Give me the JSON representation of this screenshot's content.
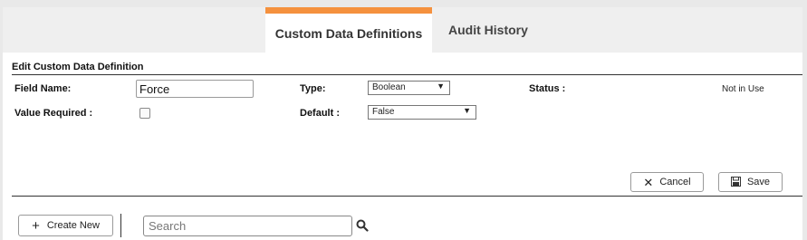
{
  "tabs": {
    "active_label": "Custom Data Definitions",
    "inactive_label": "Audit History",
    "accent_color": "#f5913e"
  },
  "form": {
    "section_title": "Edit Custom Data Definition",
    "field_name_label": "Field Name:",
    "field_name_value": "Force",
    "type_label": "Type:",
    "type_value": "Boolean",
    "status_label": "Status :",
    "status_value": "Not in Use",
    "value_required_label": "Value Required :",
    "value_required_checked": false,
    "default_label": "Default :",
    "default_value": "False"
  },
  "actions": {
    "cancel_label": "Cancel",
    "save_label": "Save"
  },
  "toolbar": {
    "create_new_label": "Create New",
    "search_placeholder": "Search"
  },
  "icons": {
    "cancel": "close-icon",
    "save": "save-icon",
    "create_new": "plus-icon",
    "search": "search-icon",
    "dropdown": "caret-down-icon"
  }
}
